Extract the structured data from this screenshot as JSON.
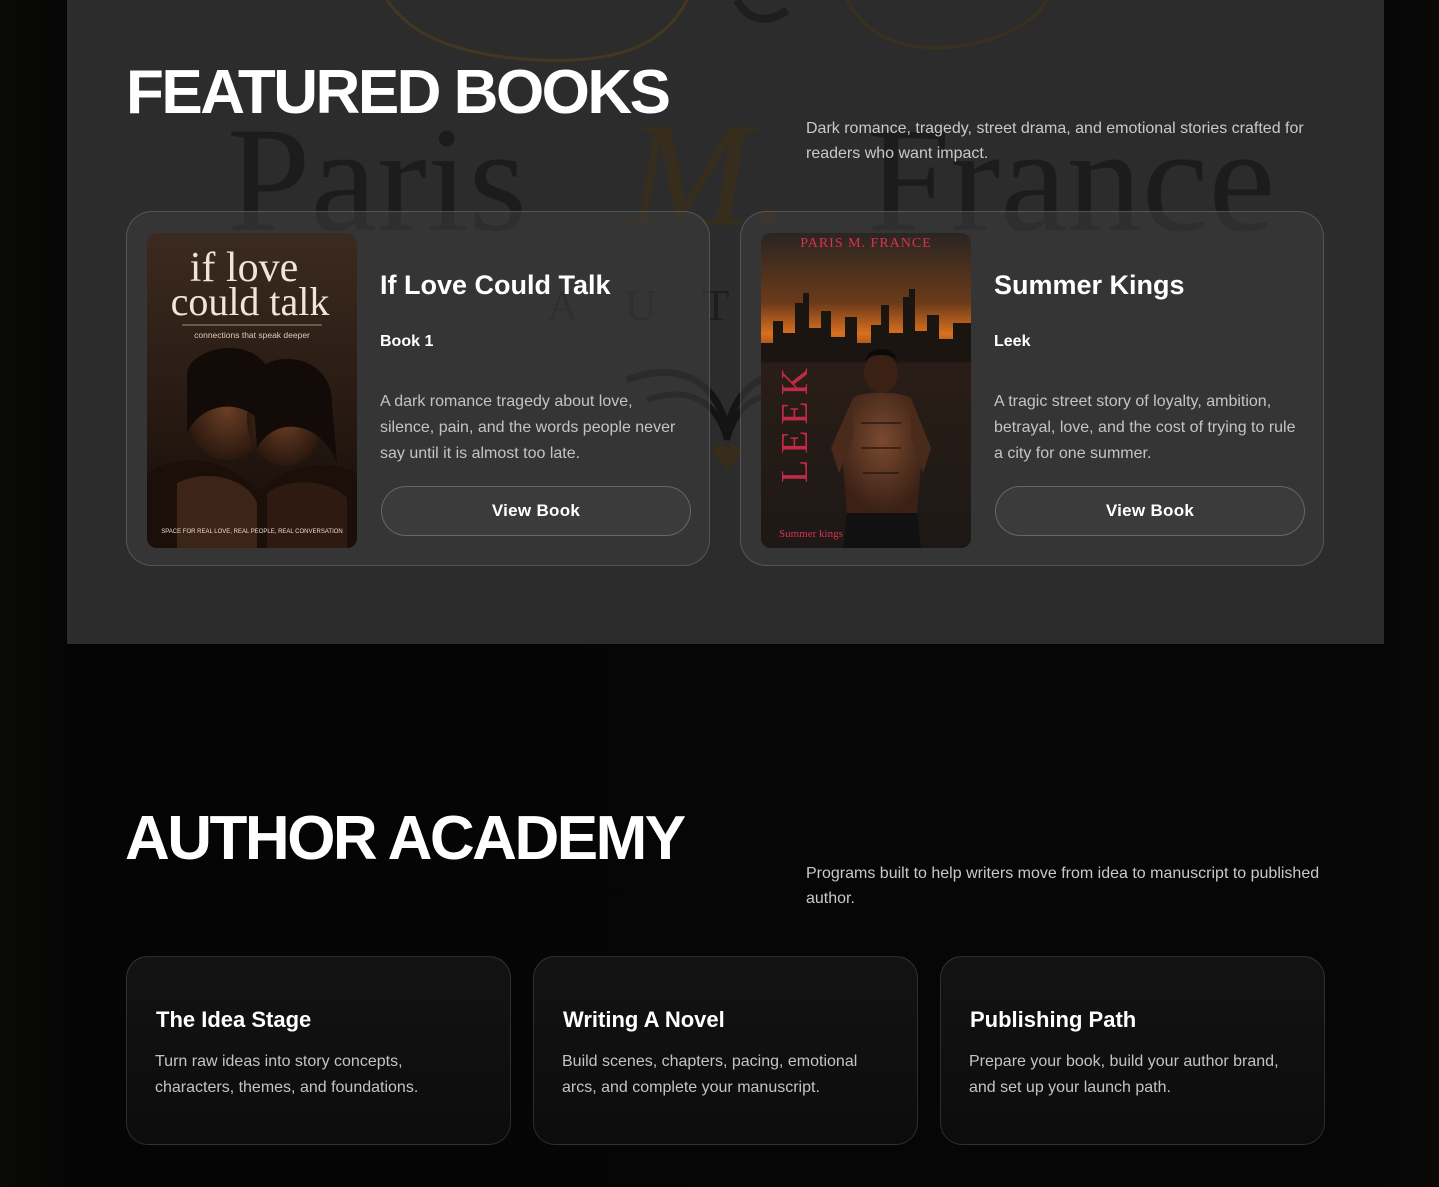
{
  "watermark": {
    "script_name": "Paris",
    "initial": "M.",
    "surname": "France",
    "tagline": "AUTHOR"
  },
  "featured": {
    "title": "FEATURED BOOKS",
    "description": "Dark romance, tragedy, street drama, and emotional stories crafted for readers who want impact.",
    "books": [
      {
        "title": "If Love Could Talk",
        "subtitle": "Book 1",
        "description": "A dark romance tragedy about love, silence, pain, and the words people never say until it is almost too late.",
        "button": "View Book",
        "cover": {
          "line1": "if love",
          "line2": "could talk",
          "tagline": "connections that speak deeper",
          "footer": "SPACE FOR REAL LOVE, REAL PEOPLE, REAL CONVERSATION"
        }
      },
      {
        "title": "Summer Kings",
        "subtitle": "Leek",
        "description": "A tragic street story of loyalty, ambition, betrayal, love, and the cost of trying to rule a city for one summer.",
        "button": "View Book",
        "cover": {
          "author": "PARIS M. FRANCE",
          "vertical": "LEEK",
          "footer": "Summer kings"
        }
      }
    ]
  },
  "academy": {
    "title": "AUTHOR ACADEMY",
    "description": "Programs built to help writers move from idea to manuscript to published author.",
    "programs": [
      {
        "title": "The Idea Stage",
        "description": "Turn raw ideas into story concepts, characters, themes, and foundations."
      },
      {
        "title": "Writing A Novel",
        "description": "Build scenes, chapters, pacing, emotional arcs, and complete your manuscript."
      },
      {
        "title": "Publishing Path",
        "description": "Prepare your book, build your author brand, and set up your launch path."
      }
    ]
  },
  "colors": {
    "page_bg": "#070707",
    "featured_bg": "#2c2c2c",
    "card_border": "#5a5a5a",
    "accent_red": "#d8324f",
    "gold": "#8a6a2a"
  }
}
